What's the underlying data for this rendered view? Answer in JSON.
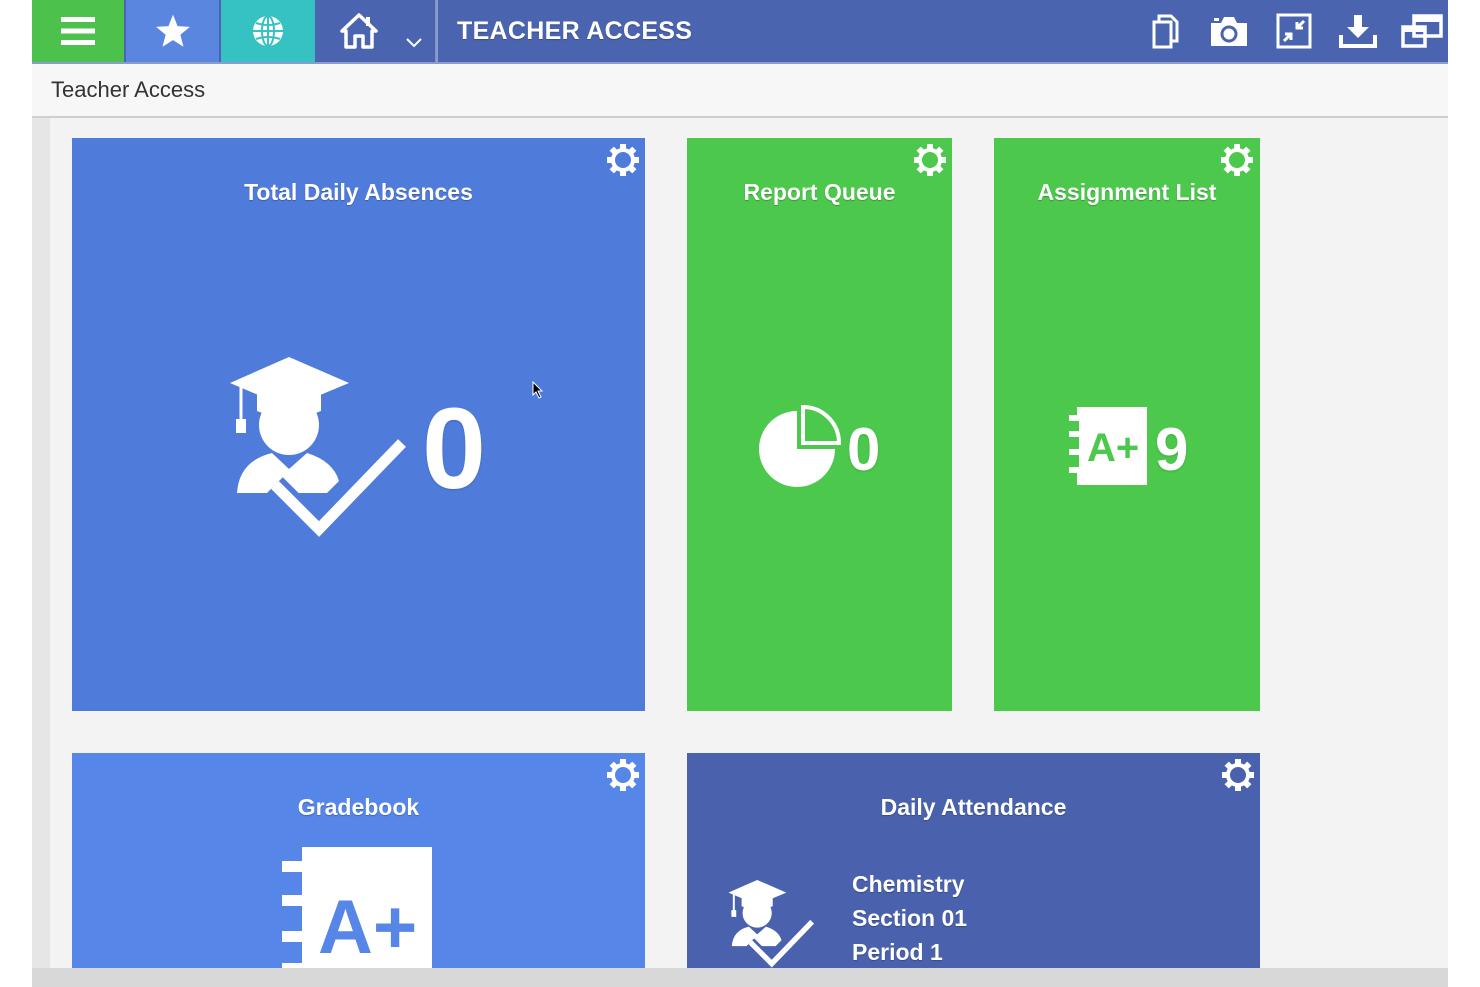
{
  "colors": {
    "menu_green": "#4cc24c",
    "star_blue": "#5a86e0",
    "globe_teal": "#36c2c2",
    "topbar_navy": "#4a64b0",
    "tile_blue": "#4f7bdb",
    "tile_green": "#4cc84c",
    "tile_light_blue": "#5686e8",
    "tile_navy": "#4a62ad"
  },
  "topbar": {
    "title": "TEACHER ACCESS",
    "left_icons": [
      "menu-icon",
      "star-icon",
      "globe-icon",
      "home-icon",
      "chevron-down-icon"
    ],
    "right_icons": [
      "copy-icon",
      "camera-icon",
      "compress-icon",
      "download-icon",
      "new-window-icon"
    ]
  },
  "breadcrumb": "Teacher Access",
  "tiles": {
    "absences": {
      "title": "Total Daily Absences",
      "value": "0",
      "icon": "student-check-icon"
    },
    "report_queue": {
      "title": "Report Queue",
      "value": "0",
      "icon": "pie-chart-icon"
    },
    "assignments": {
      "title": "Assignment List",
      "value": "9",
      "icon": "grade-notebook-icon"
    },
    "gradebook": {
      "title": "Gradebook",
      "icon": "grade-notebook-icon",
      "grade": "A+"
    },
    "attendance": {
      "title": "Daily Attendance",
      "icon": "student-check-icon",
      "course": "Chemistry",
      "section": "Section 01",
      "period": "Period 1"
    }
  }
}
